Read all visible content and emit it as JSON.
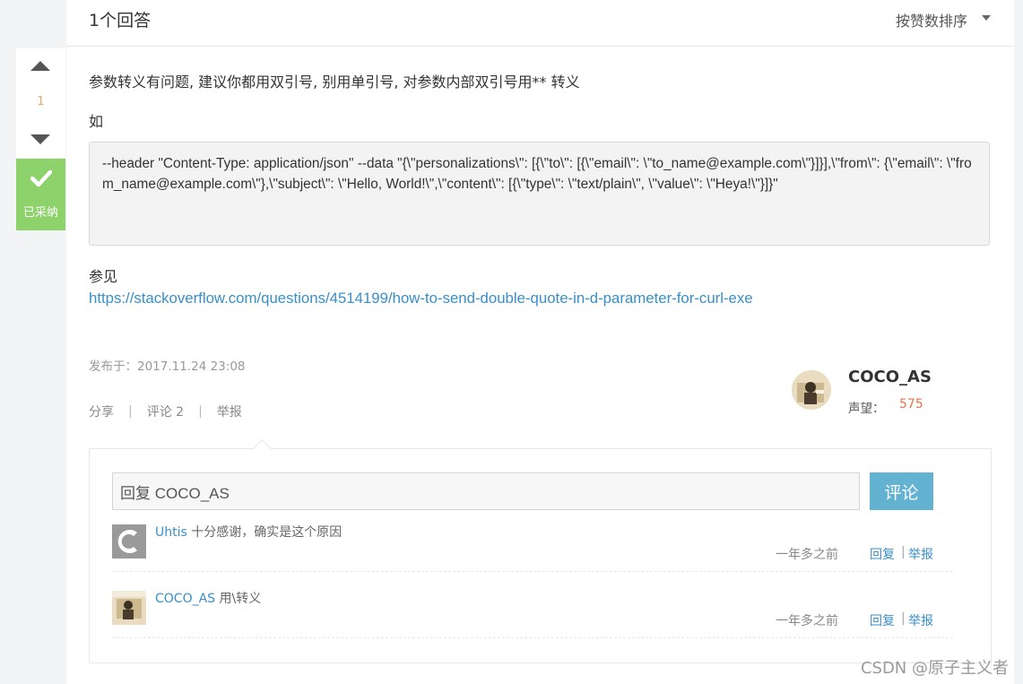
{
  "header": {
    "answer_count": "1个回答",
    "sort_label": "按赞数排序"
  },
  "vote": {
    "count": "1",
    "accepted_label": "已采纳"
  },
  "answer": {
    "paragraph1": "参数转义有问题, 建议你都用双引号, 别用单引号, 对参数内部双引号用** 转义",
    "paragraph2": "如",
    "code": "--header \"Content-Type: application/json\" --data \"{\\\"personalizations\\\": [{\\\"to\\\": [{\\\"email\\\": \\\"to_name@example.com\\\"}]}],\\\"from\\\": {\\\"email\\\": \\\"from_name@example.com\\\"},\\\"subject\\\": \\\"Hello, World!\\\",\\\"content\\\": [{\\\"type\\\": \\\"text/plain\\\", \\\"value\\\": \\\"Heya!\\\"}]}\"",
    "paragraph3": "参见",
    "link": "https://stackoverflow.com/questions/4514199/how-to-send-double-quote-in-d-parameter-for-curl-exe",
    "published": "发布于：2017.11.24 23:08"
  },
  "actions": {
    "share": "分享",
    "comment": "评论 2",
    "report": "举报",
    "separator": "|"
  },
  "author": {
    "name": "COCO_AS",
    "reputation_label": "声望：",
    "reputation": "575"
  },
  "comments": {
    "input_value": "回复 COCO_AS",
    "submit_label": "评论",
    "items": [
      {
        "user": "Uhtis",
        "text": " 十分感谢，确实是这个原因",
        "time": "一年多之前",
        "reply": "回复",
        "pipe": "|",
        "report": "举报"
      },
      {
        "user": "COCO_AS",
        "text": " 用\\转义",
        "time": "一年多之前",
        "reply": "回复",
        "pipe": "|",
        "report": "举报"
      }
    ]
  },
  "watermark": "CSDN @原子主义者",
  "colors": {
    "accepted_green": "#8dd26b",
    "link_blue": "#3a8fc8",
    "button_blue": "#64b2d1",
    "vote_orange": "#f0a35a",
    "reputation_orange": "#e8734a"
  }
}
